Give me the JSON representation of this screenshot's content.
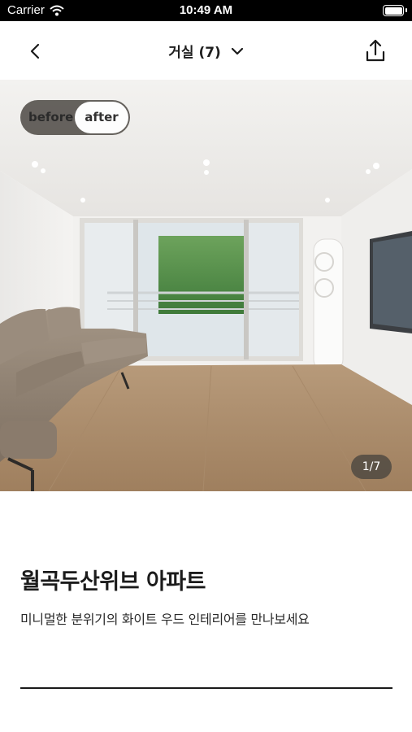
{
  "status_bar": {
    "carrier": "Carrier",
    "time": "10:49 AM"
  },
  "header": {
    "title": "거실 (7)"
  },
  "compare_toggle": {
    "before_label": "before",
    "after_label": "after",
    "selected": "after"
  },
  "gallery": {
    "counter": "1/7"
  },
  "content": {
    "title": "월곡두산위브 아파트",
    "description": "미니멀한 분위기의 화이트 우드 인테리어를 만나보세요"
  },
  "icons": {
    "back": "chevron-left-icon",
    "dropdown": "chevron-down-icon",
    "share": "share-upload-icon",
    "wifi": "wifi-icon",
    "battery": "battery-icon"
  }
}
